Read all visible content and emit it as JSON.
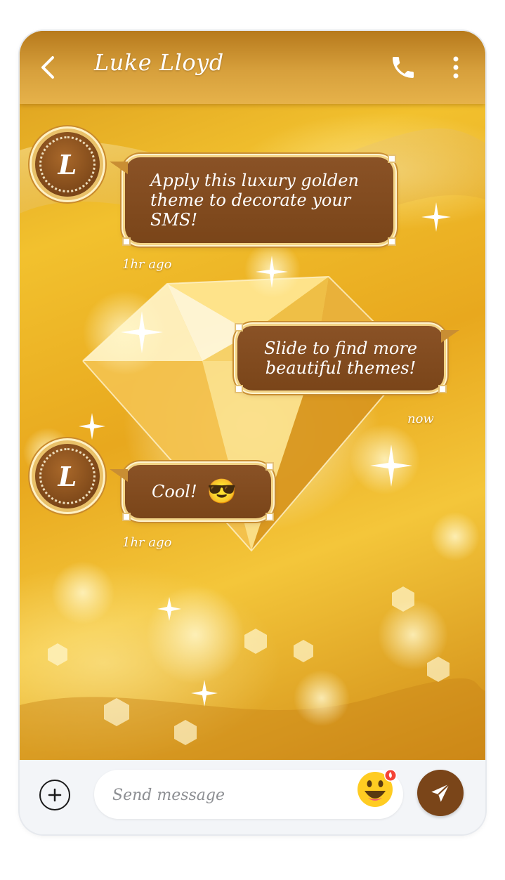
{
  "header": {
    "title": "Luke Lloyd",
    "back_icon": "chevron-left-icon",
    "call_icon": "phone-icon",
    "menu_icon": "more-vertical-icon"
  },
  "contact": {
    "avatar_letter": "L"
  },
  "messages": [
    {
      "direction": "incoming",
      "text": "Apply this luxury golden theme to decorate your SMS!",
      "time": "1hr ago"
    },
    {
      "direction": "outgoing",
      "text": "Slide to find more beautiful themes!",
      "time": "now"
    },
    {
      "direction": "incoming",
      "text": "Cool!",
      "emoji": "😎",
      "time": "1hr ago"
    }
  ],
  "composer": {
    "placeholder": "Send message",
    "add_icon": "plus-circle-icon",
    "emoji_icon": "grinning-face-icon",
    "send_icon": "paper-plane-icon"
  },
  "colors": {
    "bubble": "#7a4519",
    "bubble_border": "#f3d486",
    "accent": "#7a4519",
    "background": "#f2c12e"
  }
}
